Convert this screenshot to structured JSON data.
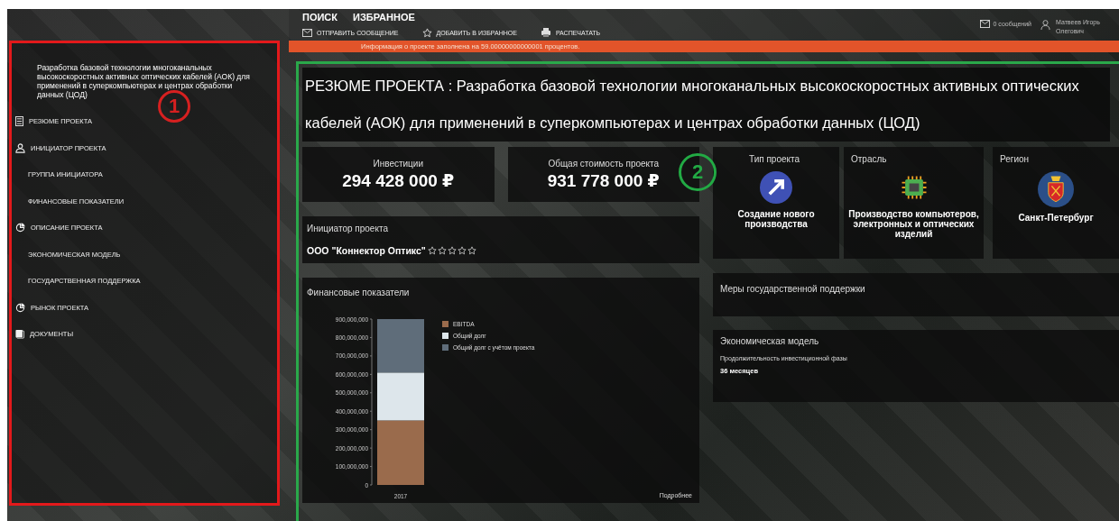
{
  "header": {
    "nav": [
      {
        "label": "ПОИСК"
      },
      {
        "label": "ИЗБРАННОЕ"
      }
    ],
    "actions": [
      {
        "label": "ОТПРАВИТЬ СООБЩЕНИЕ"
      },
      {
        "label": "ДОБАВИТЬ В ИЗБРАННОЕ"
      },
      {
        "label": "РАСПЕЧАТАТЬ"
      }
    ],
    "messages": "0 сообщений",
    "user": "Матвеев Игорь Олегович"
  },
  "notice": "Информация о проекте заполнена на 59.00000000000001 процентов.",
  "sidebar": {
    "title": "Разработка базовой технологии многоканальных высокоскоростных активных оптических кабелей (АОК) для применений в суперкомпьютерах и центрах обработки данных (ЦОД)",
    "items": [
      {
        "label": "РЕЗЮМЕ ПРОЕКТА"
      },
      {
        "label": "ИНИЦИАТОР ПРОЕКТА",
        "children": [
          {
            "label": "ГРУППА ИНИЦИАТОРА"
          },
          {
            "label": "ФИНАНСОВЫЕ ПОКАЗАТЕЛИ"
          }
        ]
      },
      {
        "label": "ОПИСАНИЕ ПРОЕКТА",
        "children": [
          {
            "label": "ЭКОНОМИЧЕСКАЯ МОДЕЛЬ"
          },
          {
            "label": "ГОСУДАРСТВЕННАЯ ПОДДЕРЖКА"
          }
        ]
      },
      {
        "label": "РЫНОК ПРОЕКТА"
      },
      {
        "label": "ДОКУМЕНТЫ"
      }
    ]
  },
  "main": {
    "title": "РЕЗЮМЕ ПРОЕКТА : Разработка базовой технологии многоканальных высокоскоростных активных оптических кабелей (АОК) для применений в суперкомпьютерах и центрах обработки данных (ЦОД)",
    "money": [
      {
        "label": "Инвестиции",
        "value": "294 428 000 ₽"
      },
      {
        "label": "Общая стоимость проекта",
        "value": "931 778 000 ₽"
      }
    ],
    "facts": [
      {
        "label": "Тип проекта",
        "value": "Создание нового производства"
      },
      {
        "label": "Отрасль",
        "value": "Производство компьютеров, электронных и оптических изделий"
      },
      {
        "label": "Регион",
        "value": "Санкт-Петербург"
      }
    ],
    "initiator": {
      "title": "Инициатор проекта",
      "name": "ООО \"Коннектор Оптикс\"",
      "stars": 0
    },
    "finance": {
      "title": "Финансовые показатели",
      "more": "Подробнее",
      "chart_data": {
        "type": "bar",
        "stacked": true,
        "legend": "right",
        "categories": [
          "2017"
        ],
        "series": [
          {
            "name": "EBITDA",
            "color": "#9a6b4c",
            "values": [
              350000000
            ]
          },
          {
            "name": "Общий долг",
            "color": "#dde6eb",
            "values": [
              260000000
            ]
          },
          {
            "name": "Общий долг с учётом проекта",
            "color": "#5f6d7a",
            "values": [
              290000000
            ]
          }
        ],
        "ylim": [
          0,
          900000000
        ],
        "yticks": [
          {
            "value": 0,
            "label": "0"
          },
          {
            "value": 100000000,
            "label": "100,000,000"
          },
          {
            "value": 200000000,
            "label": "200,000,000"
          },
          {
            "value": 300000000,
            "label": "300,000,000"
          },
          {
            "value": 400000000,
            "label": "400,000,000"
          },
          {
            "value": 500000000,
            "label": "500,000,000"
          },
          {
            "value": 600000000,
            "label": "600,000,000"
          },
          {
            "value": 700000000,
            "label": "700,000,000"
          },
          {
            "value": 800000000,
            "label": "800,000,000"
          },
          {
            "value": 900000000,
            "label": "900,000,000"
          }
        ]
      }
    },
    "support": {
      "title": "Меры государственной поддержки"
    },
    "economics": {
      "title": "Экономическая модель",
      "field": "Продолжительность инвестиционной фазы",
      "value": "36 месяцев"
    }
  },
  "annotations": [
    {
      "label": "1"
    },
    {
      "label": "2"
    }
  ]
}
